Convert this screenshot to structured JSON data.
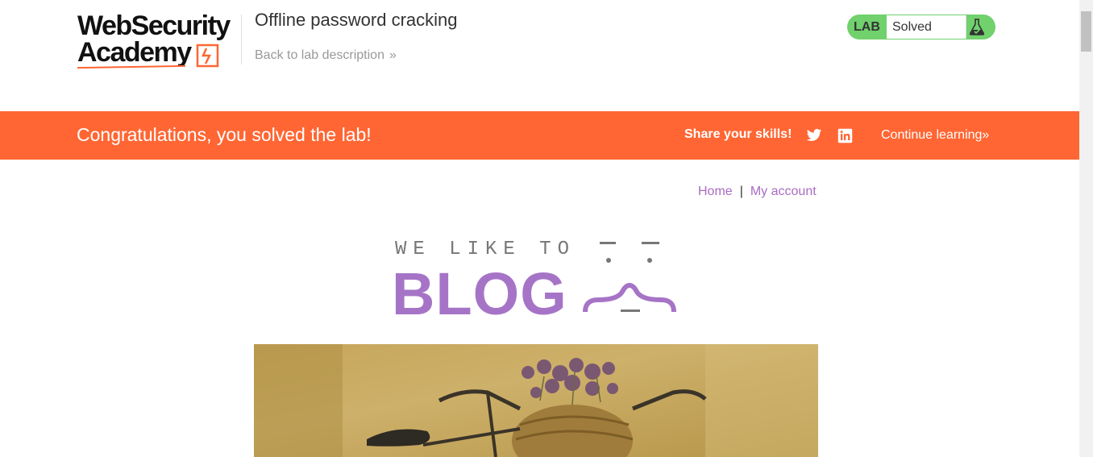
{
  "header": {
    "logo_line1": "WebSecurity",
    "logo_line2": "Academy",
    "lab_title": "Offline password cracking",
    "back_link": "Back to lab description",
    "back_chevron": "»",
    "lab_badge": "LAB",
    "lab_status": "Solved",
    "status_icon": "flask-icon"
  },
  "banner": {
    "message": "Congratulations, you solved the lab!",
    "share_label": "Share your skills!",
    "social_icons": [
      "twitter-icon",
      "linkedin-icon"
    ],
    "continue_label": "Continue learning",
    "continue_chevron": "»"
  },
  "nav": {
    "home": "Home",
    "separator": "|",
    "my_account": "My account"
  },
  "blog_logo": {
    "top_text": "WE LIKE TO",
    "main_text": "BLOG"
  },
  "colors": {
    "accent_orange": "#ff6633",
    "solved_green": "#70d16d",
    "link_purple": "#a96cc1",
    "blog_purple": "#a674c7"
  }
}
